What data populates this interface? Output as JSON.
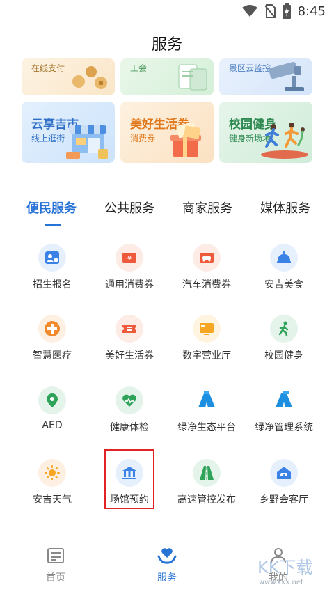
{
  "status_bar": {
    "time": "8:45"
  },
  "page": {
    "title": "服务"
  },
  "banners_top": [
    {
      "subtitle": "在线支付"
    },
    {
      "subtitle": "工会"
    },
    {
      "subtitle": "景区云监控"
    }
  ],
  "banners": [
    {
      "title": "云享吉市",
      "subtitle": "线上逛街"
    },
    {
      "title": "美好生活券",
      "subtitle": "消费券"
    },
    {
      "title": "校园健身",
      "subtitle": "健身新场地"
    }
  ],
  "tabs": [
    {
      "label": "便民服务"
    },
    {
      "label": "公共服务"
    },
    {
      "label": "商家服务"
    },
    {
      "label": "媒体服务"
    }
  ],
  "services": [
    {
      "label": "招生报名",
      "icon": "student-id-icon"
    },
    {
      "label": "通用消费券",
      "icon": "coupon-icon"
    },
    {
      "label": "汽车消费券",
      "icon": "car-coupon-icon"
    },
    {
      "label": "安吉美食",
      "icon": "food-cloche-icon"
    },
    {
      "label": "智慧医疗",
      "icon": "medical-cross-icon"
    },
    {
      "label": "美好生活券",
      "icon": "ticket-icon"
    },
    {
      "label": "数字营业厅",
      "icon": "tv-hall-icon"
    },
    {
      "label": "校园健身",
      "icon": "running-icon"
    },
    {
      "label": "AED",
      "icon": "location-pin-icon"
    },
    {
      "label": "健康体检",
      "icon": "heart-pulse-icon"
    },
    {
      "label": "绿净生态平台",
      "icon": "road-ecology-icon"
    },
    {
      "label": "绿净管理系统",
      "icon": "road-management-icon"
    },
    {
      "label": "安吉天气",
      "icon": "sun-icon"
    },
    {
      "label": "场馆预约",
      "icon": "museum-icon"
    },
    {
      "label": "高速管控发布",
      "icon": "highway-icon"
    },
    {
      "label": "乡野会客厅",
      "icon": "house-icon"
    }
  ],
  "bottom_nav": [
    {
      "label": "首页",
      "icon": "newspaper-icon"
    },
    {
      "label": "服务",
      "icon": "heart-hand-icon"
    },
    {
      "label": "我的",
      "icon": "user-icon"
    }
  ],
  "watermark": {
    "text": "KK下载",
    "url": "www.kkx.net"
  },
  "colors": {
    "accent": "#2773d6",
    "highlight": "#e02424"
  }
}
